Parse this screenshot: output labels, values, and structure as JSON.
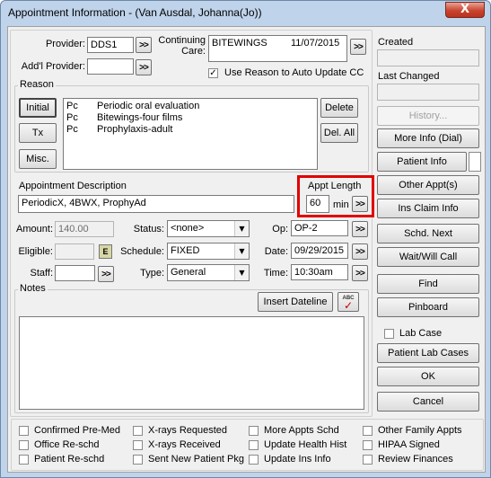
{
  "window": {
    "title": "Appointment Information - (Van Ausdal, Johanna(Jo))",
    "close_label": "X"
  },
  "provider": {
    "label": "Provider:",
    "value": "DDS1",
    "addl_label": "Add'l Provider:",
    "addl_value": ""
  },
  "continuing_care": {
    "label1": "Continuing",
    "label2": "Care:",
    "value": "BITEWINGS",
    "date": "11/07/2015",
    "use_reason_label": "Use Reason to Auto Update CC",
    "use_reason_checked": true
  },
  "reason": {
    "group_label": "Reason",
    "buttons": {
      "initial": "Initial",
      "tx": "Tx",
      "misc": "Misc.",
      "delete": "Delete",
      "del_all": "Del. All"
    },
    "items": [
      {
        "code": "Pc",
        "desc": "Periodic oral evaluation"
      },
      {
        "code": "Pc",
        "desc": "Bitewings-four films"
      },
      {
        "code": "Pc",
        "desc": "Prophylaxis-adult"
      }
    ]
  },
  "appt_desc": {
    "label": "Appointment Description",
    "value": "PeriodicX, 4BWX, ProphyAd"
  },
  "appt_length": {
    "label": "Appt Length",
    "value": "60",
    "unit": "min",
    "highlight_color": "#e00000"
  },
  "billing": {
    "amount_label": "Amount:",
    "amount_value": "140.00",
    "eligible_label": "Eligible:",
    "eligible_value": "",
    "eligible_btn": "E",
    "staff_label": "Staff:",
    "staff_value": ""
  },
  "status": {
    "label": "Status:",
    "value": "<none>"
  },
  "schedule": {
    "label": "Schedule:",
    "value": "FIXED"
  },
  "type": {
    "label": "Type:",
    "value": "General"
  },
  "op": {
    "label": "Op:",
    "value": "OP-2"
  },
  "date": {
    "label": "Date:",
    "value": "09/29/2015"
  },
  "time": {
    "label": "Time:",
    "value": "10:30am"
  },
  "notes": {
    "label": "Notes",
    "insert_dateline": "Insert Dateline",
    "spell_icon_text": "ABC",
    "text": ""
  },
  "side": {
    "created_label": "Created",
    "created_value": "",
    "changed_label": "Last Changed",
    "changed_value": "",
    "history": "History...",
    "more_info": "More Info (Dial)",
    "patient_info": "Patient Info",
    "other_appts": "Other Appt(s)",
    "ins_claim": "Ins Claim Info",
    "schd_next": "Schd. Next",
    "wait_call": "Wait/Will Call",
    "find": "Find",
    "pinboard": "Pinboard",
    "lab_case": "Lab Case",
    "patient_lab_cases": "Patient Lab Cases",
    "ok": "OK",
    "cancel": "Cancel"
  },
  "chevron": ">>",
  "checks": [
    {
      "label": "Confirmed Pre-Med",
      "checked": false
    },
    {
      "label": "Office Re-schd",
      "checked": false
    },
    {
      "label": "Patient Re-schd",
      "checked": false
    },
    {
      "label": "X-rays Requested",
      "checked": false
    },
    {
      "label": "X-rays Received",
      "checked": false
    },
    {
      "label": "Sent New Patient Pkg",
      "checked": false
    },
    {
      "label": "More Appts Schd",
      "checked": false
    },
    {
      "label": "Update Health Hist",
      "checked": false
    },
    {
      "label": "Update Ins Info",
      "checked": false
    },
    {
      "label": "Other Family Appts",
      "checked": false
    },
    {
      "label": "HIPAA Signed",
      "checked": false
    },
    {
      "label": "Review Finances",
      "checked": false
    }
  ]
}
